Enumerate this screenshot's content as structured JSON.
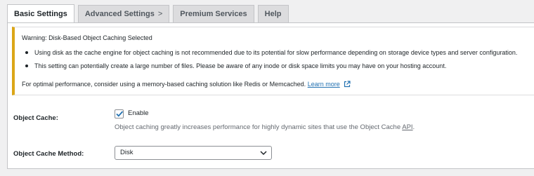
{
  "tabs": [
    {
      "label": "Basic Settings",
      "active": true
    },
    {
      "label": "Advanced Settings",
      "chevron": ">",
      "active": false
    },
    {
      "label": "Premium Services",
      "active": false
    },
    {
      "label": "Help",
      "active": false
    }
  ],
  "notice": {
    "title": "Warning: Disk-Based Object Caching Selected",
    "bullets": [
      "Using disk as the cache engine for object caching is not recommended due to its potential for slow performance depending on storage device types and server configuration.",
      "This setting can potentially create a large number of files. Please be aware of any inode or disk space limits you may have on your hosting account."
    ],
    "footer_text": "For optimal performance, consider using a memory-based caching solution like Redis or Memcached.",
    "learn_more": "Learn more",
    "accent_color": "#dba617",
    "icon": "external-link-icon"
  },
  "object_cache": {
    "label": "Object Cache:",
    "checkbox_label": "Enable",
    "checked": true,
    "description_prefix": "Object caching greatly increases performance for highly dynamic sites that use the Object Cache ",
    "description_abbr": "API",
    "description_suffix": "."
  },
  "object_cache_method": {
    "label": "Object Cache Method:",
    "selected": "Disk"
  },
  "colors": {
    "link": "#2271b1",
    "background": "#f0f0f1",
    "tab_inactive": "#dcdcde"
  }
}
